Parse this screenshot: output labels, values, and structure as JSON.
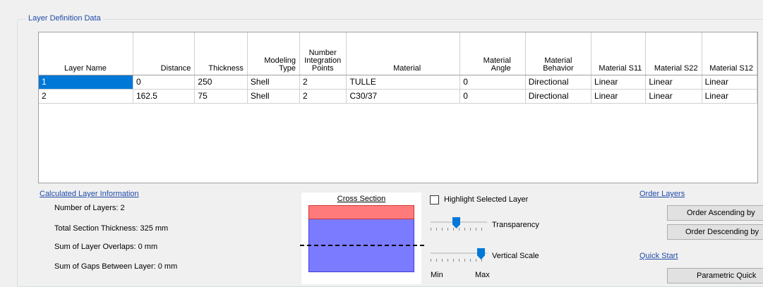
{
  "group": {
    "title": "Layer Definition Data"
  },
  "table": {
    "columns": [
      "Layer Name",
      "Distance",
      "Thickness",
      "Modeling Type",
      "Number Integration Points",
      "Material",
      "Material Angle",
      "Material Behavior",
      "Material S11",
      "Material S22",
      "Material S12"
    ],
    "rows": [
      [
        "1",
        "0",
        "250",
        "Shell",
        "2",
        "TULLE",
        "0",
        "Directional",
        "Linear",
        "Linear",
        "Linear"
      ],
      [
        "2",
        "162.5",
        "75",
        "Shell",
        "2",
        "C30/37",
        "0",
        "Directional",
        "Linear",
        "Linear",
        "Linear"
      ]
    ]
  },
  "calc": {
    "link": "Calculated Layer Information",
    "num_layers": "Number of Layers:  2",
    "total_thickness": "Total Section Thickness:  325 mm",
    "overlaps": "Sum of Layer Overlaps:  0 mm",
    "gaps": "Sum of Gaps Between Layer:  0 mm"
  },
  "cross_section": {
    "title": "Cross Section",
    "top_color": "#ff7b7b",
    "bottom_color": "#7b7bff"
  },
  "display": {
    "highlight_label": "Highlight Selected Layer",
    "highlight_checked": false,
    "transparency_label": "Transparency",
    "transparency_level": 0.45,
    "vertical_scale_label": "Vertical Scale",
    "vertical_scale_level": 0.95,
    "min_label": "Min",
    "max_label": "Max"
  },
  "order": {
    "link": "Order Layers",
    "ascending": "Order Ascending by",
    "descending": "Order Descending by"
  },
  "quick": {
    "link": "Quick Start",
    "button": "Parametric Quick"
  }
}
